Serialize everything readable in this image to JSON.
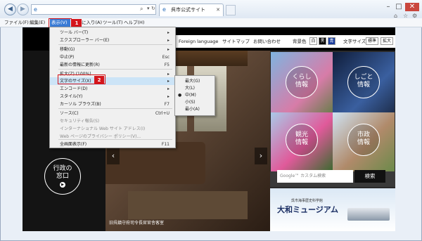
{
  "browser": {
    "address_text": "",
    "tab_title": "呉市公式サイト",
    "menubar": [
      {
        "label": "ファイル(F)"
      },
      {
        "label": "編集(E)"
      },
      {
        "label": "表示(V)"
      },
      {
        "label": "に入り(A)"
      },
      {
        "label": "ツール(T)"
      },
      {
        "label": "ヘルプ(H)"
      }
    ]
  },
  "view_menu": {
    "items": [
      {
        "label": "ツール バー(T)",
        "shortcut": "▸",
        "disabled": false
      },
      {
        "label": "エクスプローラー バー(E)",
        "shortcut": "▸",
        "disabled": false
      },
      {
        "label": "移動(G)",
        "shortcut": "▸",
        "disabled": false
      },
      {
        "label": "中止(P)",
        "shortcut": "Esc",
        "disabled": false
      },
      {
        "label": "最新の情報に更新(R)",
        "shortcut": "F5",
        "disabled": false
      },
      {
        "label": "拡大(Z) (100%)",
        "shortcut": "▸",
        "disabled": false
      },
      {
        "label": "文字のサイズ(X)",
        "shortcut": "▸",
        "disabled": false
      },
      {
        "label": "エンコード(D)",
        "shortcut": "▸",
        "disabled": false
      },
      {
        "label": "スタイル(Y)",
        "shortcut": "▸",
        "disabled": false
      },
      {
        "label": "カーソル ブラウズ(B)",
        "shortcut": "F7",
        "disabled": false
      },
      {
        "label": "ソース(C)",
        "shortcut": "Ctrl+U",
        "disabled": false
      },
      {
        "label": "セキュリティ報告(S)",
        "shortcut": "",
        "disabled": true
      },
      {
        "label": "インターナショナル Web サイト アドレス(I)",
        "shortcut": "",
        "disabled": true
      },
      {
        "label": "Web ページのプライバシー ポリシー(V)...",
        "shortcut": "",
        "disabled": true
      },
      {
        "label": "全画面表示(F)",
        "shortcut": "F11",
        "disabled": false
      }
    ]
  },
  "textsize_menu": {
    "items": [
      {
        "label": "最大(G)",
        "checked": false
      },
      {
        "label": "大(L)",
        "checked": false
      },
      {
        "label": "中(M)",
        "checked": true
      },
      {
        "label": "小(S)",
        "checked": false
      },
      {
        "label": "最小(A)",
        "checked": false
      }
    ]
  },
  "callouts": {
    "one": "1",
    "two": "2"
  },
  "site": {
    "header_links": [
      "Foreign language",
      "サイトマップ",
      "お問い合わせ"
    ],
    "bg_color_label": "背景色",
    "bg_options": [
      "白",
      "黒",
      "青"
    ],
    "text_size_label": "文字サイズ",
    "text_size_options": [
      "標準",
      "拡大"
    ],
    "tiles": [
      {
        "label_line1": "くらし",
        "label_line2": "情報"
      },
      {
        "label_line1": "しごと",
        "label_line2": "情報"
      },
      {
        "label_line1": "観光",
        "label_line2": "情報"
      },
      {
        "label_line1": "市政",
        "label_line2": "情報"
      }
    ],
    "window_badge_line1": "行政の",
    "window_badge_line2": "窓口",
    "search_placeholder": "Google™ カスタム検索",
    "search_button": "検索",
    "hero_caption": "旧呉鎮守府司令長官官舎客室",
    "banner_small": "呉市海事歴史科学館",
    "banner_big": "大和ミュージアム"
  },
  "colors": {
    "accent_red": "#d4151b",
    "menu_highlight": "#cce4f7",
    "selected_menu": "#3a7bd5"
  }
}
